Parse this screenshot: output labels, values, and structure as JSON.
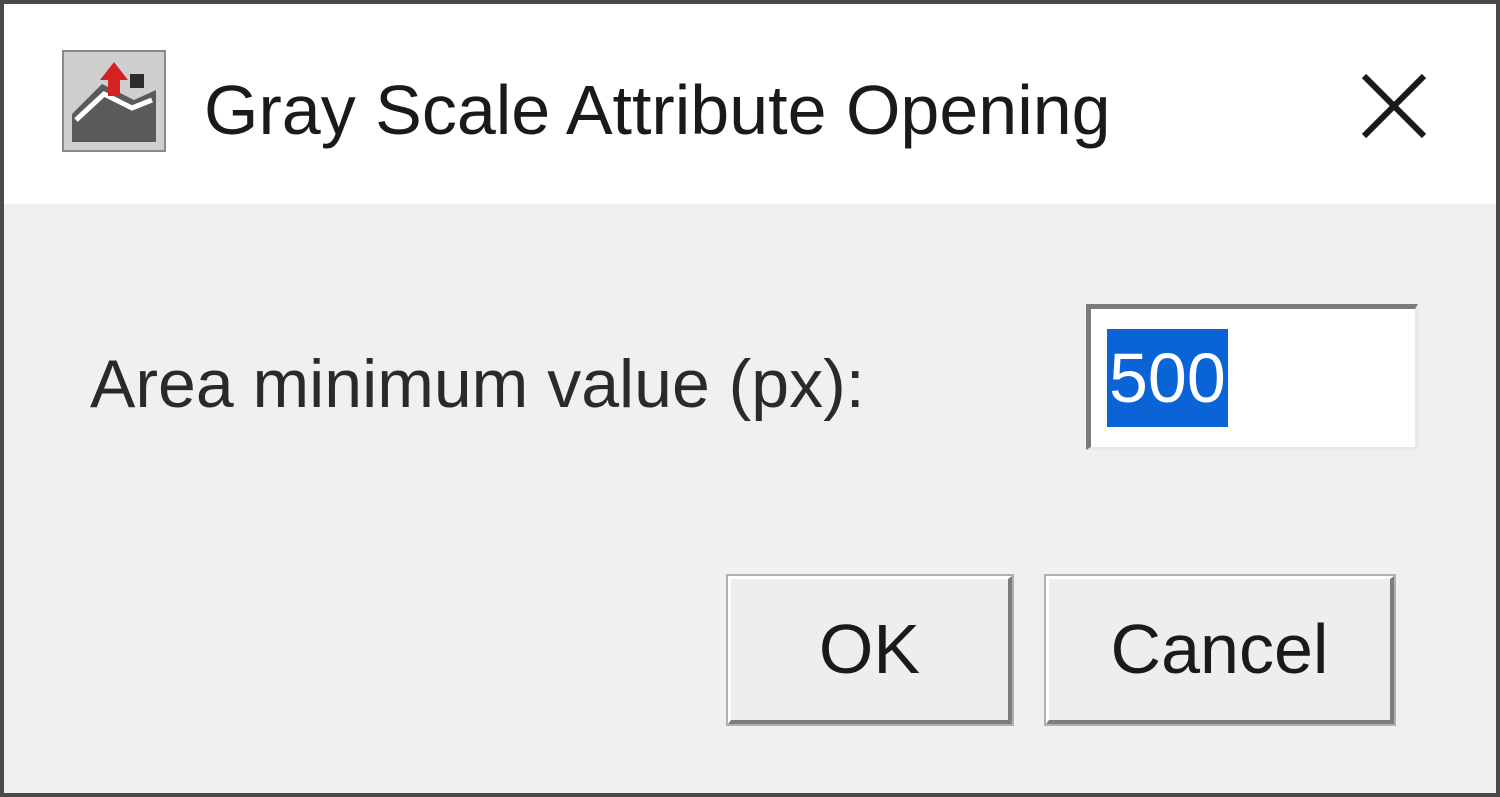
{
  "window": {
    "title": "Gray Scale Attribute Opening",
    "icon": "imagej-plugin-icon",
    "close_icon": "close-icon"
  },
  "form": {
    "area_label": "Area minimum value (px):",
    "area_value": "500"
  },
  "buttons": {
    "ok_label": "OK",
    "cancel_label": "Cancel"
  },
  "colors": {
    "selection": "#0a64d6",
    "dialog_bg": "#f0f0f0",
    "titlebar_bg": "#ffffff"
  }
}
